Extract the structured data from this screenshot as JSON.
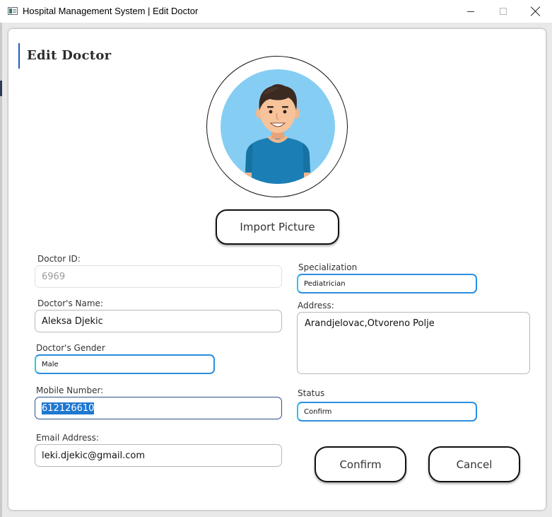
{
  "window": {
    "title": "Hospital Management System | Edit Doctor",
    "minimize_label": "minimize",
    "maximize_label": "maximize",
    "close_label": "close"
  },
  "page": {
    "heading": "Edit Doctor"
  },
  "avatar": {
    "icon": "doctor-avatar-icon",
    "import_button_label": "Import Picture"
  },
  "form": {
    "doctor_id": {
      "label": "Doctor ID:",
      "value": "6969"
    },
    "name": {
      "label": "Doctor's Name:",
      "value": "Aleksa Djekic"
    },
    "gender": {
      "label": "Doctor's Gender",
      "value": "Male"
    },
    "mobile": {
      "label": "Mobile Number:",
      "value": "612126610"
    },
    "email": {
      "label": "Email Address:",
      "value": "leki.djekic@gmail.com"
    },
    "specialization": {
      "label": "Specialization",
      "value": "Pediatrician"
    },
    "address": {
      "label": "Address:",
      "value": "Arandjelovac,Otvoreno Polje"
    },
    "status": {
      "label": "Status",
      "value": "Confirm"
    }
  },
  "actions": {
    "confirm_label": "Confirm",
    "cancel_label": "Cancel"
  },
  "colors": {
    "accent": "#1f5fbf",
    "focus_border": "#2b8fe0",
    "selection": "#1e78d0"
  }
}
